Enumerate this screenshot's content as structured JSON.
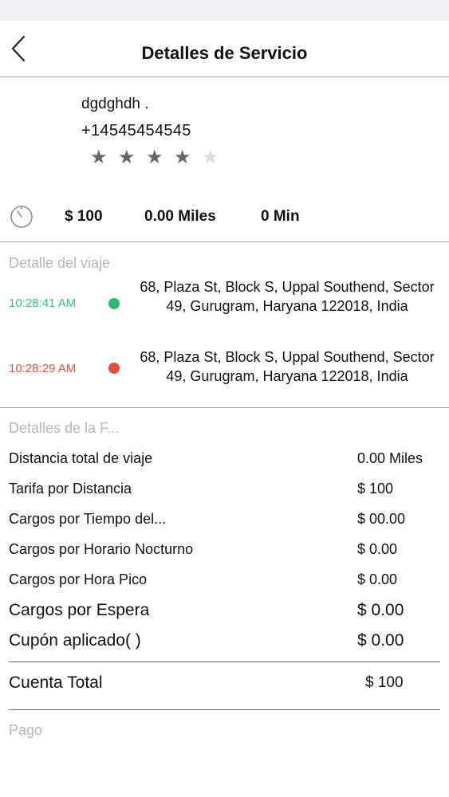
{
  "header": {
    "title": "Detalles de Servicio",
    "back_icon": "chevron-left-icon"
  },
  "driver": {
    "name": "dgdghdh .",
    "phone": "+14545454545",
    "rating": 4,
    "rating_max": 5
  },
  "summary": {
    "amount": "$ 100",
    "distance": "0.00 Miles",
    "duration": "0 Min"
  },
  "trip": {
    "title": "Detalle del viaje",
    "pickup": {
      "time": "10:28:41 AM",
      "address": "68, Plaza St, Block S, Uppal Southend, Sector 49, Gurugram, Haryana 122018, India",
      "color": "#2fb86a"
    },
    "dropoff": {
      "time": "10:28:29 AM",
      "address": "68, Plaza St, Block S, Uppal Southend, Sector 49, Gurugram, Haryana 122018, India",
      "color": "#e2503d"
    }
  },
  "fare": {
    "title": "Detalles de la F...",
    "rows": [
      {
        "label": "Distancia total de viaje",
        "value": "0.00 Miles"
      },
      {
        "label": "Tarifa por Distancia",
        "value": "$ 100"
      },
      {
        "label": "Cargos por Tiempo del...",
        "value": "$ 00.00"
      },
      {
        "label": "Cargos por Horario Nocturno",
        "value": "$ 0.00"
      },
      {
        "label": "Cargos por Hora Pico",
        "value": "$ 0.00"
      },
      {
        "label": "Cargos por Espera",
        "value": "$ 0.00"
      },
      {
        "label": "Cupón aplicado( )",
        "value": "$ 0.00"
      }
    ],
    "total_label": "Cuenta Total",
    "total_value": "$ 100"
  },
  "payment": {
    "title": "Pago"
  }
}
